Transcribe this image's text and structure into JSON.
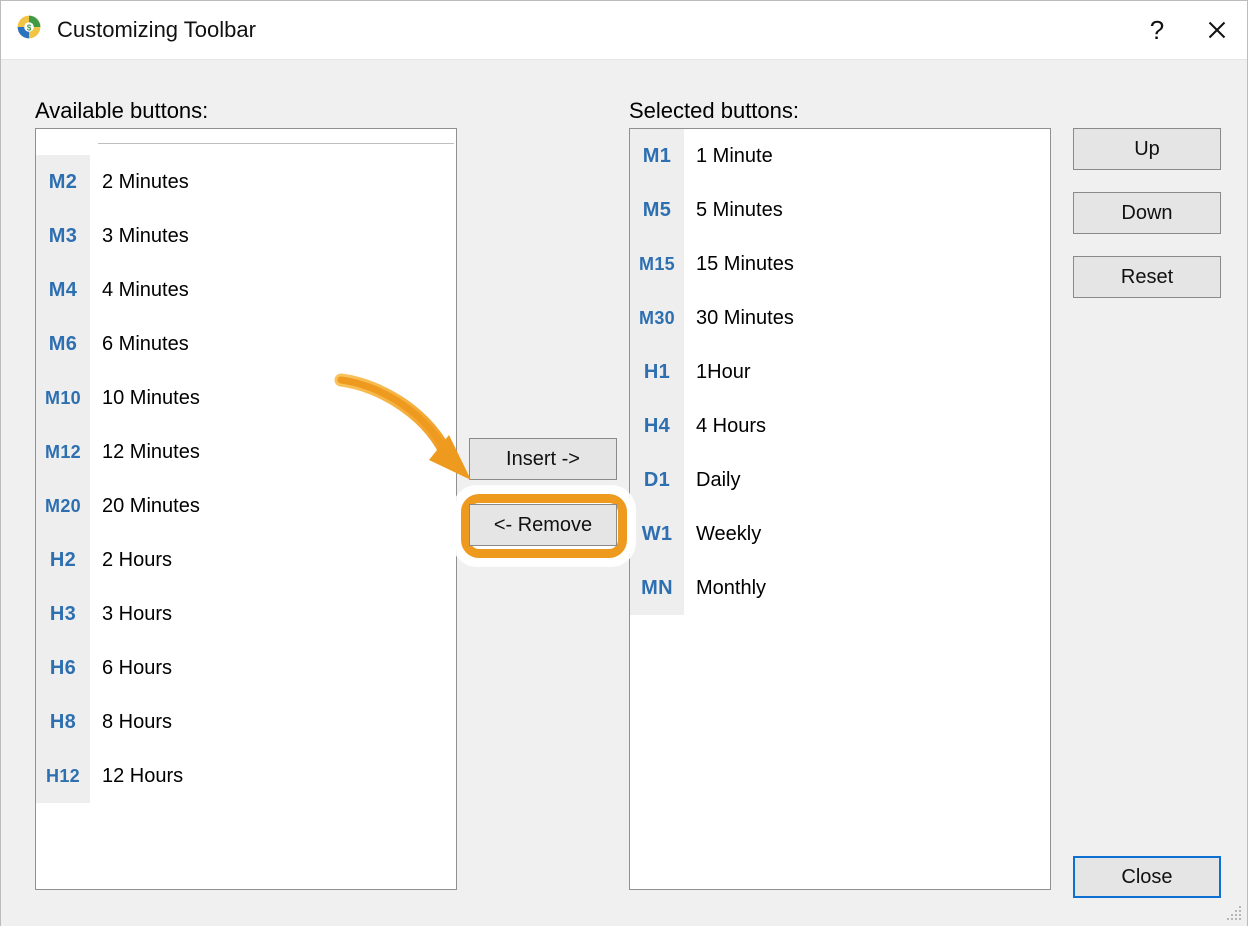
{
  "window": {
    "title": "Customizing Toolbar"
  },
  "labels": {
    "available": "Available buttons:",
    "selected": "Selected buttons:"
  },
  "available": [
    {
      "code": "M2",
      "label": "2 Minutes"
    },
    {
      "code": "M3",
      "label": "3 Minutes"
    },
    {
      "code": "M4",
      "label": "4 Minutes"
    },
    {
      "code": "M6",
      "label": "6 Minutes"
    },
    {
      "code": "M10",
      "label": "10 Minutes"
    },
    {
      "code": "M12",
      "label": "12 Minutes"
    },
    {
      "code": "M20",
      "label": "20 Minutes"
    },
    {
      "code": "H2",
      "label": "2 Hours"
    },
    {
      "code": "H3",
      "label": "3 Hours"
    },
    {
      "code": "H6",
      "label": "6 Hours"
    },
    {
      "code": "H8",
      "label": "8 Hours"
    },
    {
      "code": "H12",
      "label": "12 Hours"
    }
  ],
  "selected": [
    {
      "code": "M1",
      "label": "1 Minute"
    },
    {
      "code": "M5",
      "label": "5 Minutes"
    },
    {
      "code": "M15",
      "label": "15 Minutes"
    },
    {
      "code": "M30",
      "label": "30 Minutes"
    },
    {
      "code": "H1",
      "label": "1Hour"
    },
    {
      "code": "H4",
      "label": "4 Hours"
    },
    {
      "code": "D1",
      "label": "Daily"
    },
    {
      "code": "W1",
      "label": "Weekly"
    },
    {
      "code": "MN",
      "label": "Monthly"
    }
  ],
  "buttons": {
    "insert": "Insert ->",
    "remove": "<- Remove",
    "up": "Up",
    "down": "Down",
    "reset": "Reset",
    "close": "Close"
  },
  "annotation": {
    "arrow_color": "#ee9a1f",
    "highlight_target": "remove-button"
  }
}
